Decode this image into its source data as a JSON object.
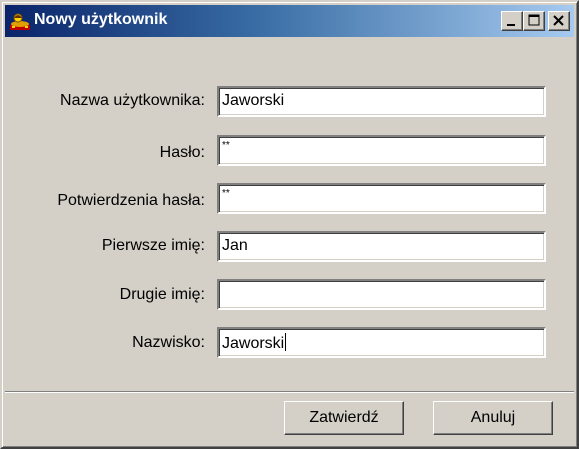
{
  "window": {
    "title": "Nowy użytkownik",
    "icon": "users-app-icon",
    "controls": {
      "minimize": "_",
      "maximize": "□",
      "close": "×"
    }
  },
  "form": {
    "fields": [
      {
        "label": "Nazwa użytkownika:",
        "value": "Jaworski",
        "type": "text"
      },
      {
        "label": "Hasło:",
        "value": "**",
        "type": "password"
      },
      {
        "label": "Potwierdzenia hasła:",
        "value": "**",
        "type": "password"
      },
      {
        "label": "Pierwsze imię:",
        "value": "Jan",
        "type": "text"
      },
      {
        "label": "Drugie imię:",
        "value": "",
        "type": "text"
      },
      {
        "label": "Nazwisko:",
        "value": "Jaworski",
        "type": "text",
        "focused": true
      }
    ]
  },
  "buttons": {
    "ok": "Zatwierdź",
    "cancel": "Anuluj"
  },
  "colors": {
    "face": "#d4d0c8",
    "titlebar_start": "#0a246a",
    "titlebar_end": "#a6caf0"
  }
}
